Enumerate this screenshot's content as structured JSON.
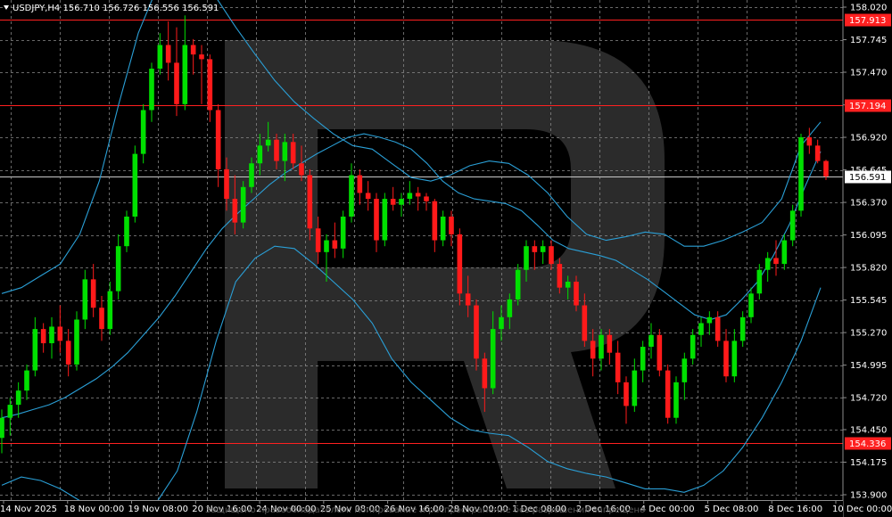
{
  "header": {
    "text": "USDJPY,H4  156.710 156.726 156.556 156.591"
  },
  "watermark": {
    "text": "Защищено правообладателем. Копирование и распространение без разрешения запрещено"
  },
  "colors": {
    "background": "#000000",
    "grid": "#8c8c8c",
    "bull": "#00e000",
    "bear": "#ff1a1a",
    "bands": "#2a9fd6",
    "level": "#ff2020",
    "current": "#c8c8c8"
  },
  "chart_data": {
    "type": "candlestick",
    "symbol": "USDJPY",
    "timeframe": "H4",
    "ohlc_readout": {
      "open": 156.71,
      "high": 156.726,
      "low": 156.556,
      "close": 156.591
    },
    "ylim": [
      153.9,
      158.02
    ],
    "y_ticks": [
      "158.020",
      "157.745",
      "157.470",
      "157.194",
      "156.920",
      "156.645",
      "156.370",
      "156.095",
      "155.820",
      "155.545",
      "155.270",
      "154.995",
      "154.720",
      "154.450",
      "154.175",
      "153.900"
    ],
    "x_ticks": [
      "14 Nov 2025",
      "18 Nov 00:00",
      "19 Nov 08:00",
      "20 Nov 16:00",
      "24 Nov 00:00",
      "25 Nov 08:00",
      "26 Nov 16:00",
      "28 Nov 00:00",
      "1 Dec 08:00",
      "2 Dec 16:00",
      "4 Dec 00:00",
      "5 Dec 08:00",
      "8 Dec 16:00",
      "10 Dec 00:00"
    ],
    "levels": [
      {
        "label": "157.913",
        "value": 157.913
      },
      {
        "label": "157.194",
        "value": 157.194
      },
      {
        "label": "154.336",
        "value": 154.336
      }
    ],
    "current_price": {
      "label": "156.591",
      "value": 156.591
    },
    "candles": [
      [
        154.38,
        154.62,
        154.25,
        154.55
      ],
      [
        154.55,
        154.72,
        154.4,
        154.66
      ],
      [
        154.66,
        154.85,
        154.55,
        154.78
      ],
      [
        154.78,
        155.0,
        154.7,
        154.95
      ],
      [
        154.95,
        155.4,
        154.9,
        155.3
      ],
      [
        155.3,
        155.35,
        155.1,
        155.18
      ],
      [
        155.18,
        155.4,
        155.05,
        155.32
      ],
      [
        155.32,
        155.5,
        155.1,
        155.2
      ],
      [
        155.2,
        155.3,
        154.9,
        155.0
      ],
      [
        155.0,
        155.45,
        154.95,
        155.38
      ],
      [
        155.38,
        155.8,
        155.3,
        155.72
      ],
      [
        155.72,
        155.85,
        155.4,
        155.48
      ],
      [
        155.48,
        155.58,
        155.2,
        155.3
      ],
      [
        155.3,
        155.7,
        155.25,
        155.62
      ],
      [
        155.62,
        156.1,
        155.55,
        156.0
      ],
      [
        156.0,
        156.3,
        155.95,
        156.25
      ],
      [
        156.25,
        156.85,
        156.2,
        156.78
      ],
      [
        156.78,
        157.2,
        156.7,
        157.15
      ],
      [
        157.15,
        157.55,
        157.05,
        157.5
      ],
      [
        157.5,
        157.8,
        157.45,
        157.7
      ],
      [
        157.7,
        157.9,
        157.4,
        157.55
      ],
      [
        157.55,
        157.85,
        157.1,
        157.2
      ],
      [
        157.2,
        157.95,
        157.15,
        157.7
      ],
      [
        157.7,
        157.75,
        157.45,
        157.62
      ],
      [
        157.62,
        157.7,
        157.2,
        157.58
      ],
      [
        157.58,
        157.62,
        157.05,
        157.15
      ],
      [
        157.15,
        157.2,
        156.5,
        156.65
      ],
      [
        156.65,
        156.75,
        156.3,
        156.4
      ],
      [
        156.4,
        156.6,
        156.1,
        156.2
      ],
      [
        156.2,
        156.55,
        156.15,
        156.5
      ],
      [
        156.5,
        156.75,
        156.45,
        156.7
      ],
      [
        156.7,
        156.95,
        156.6,
        156.85
      ],
      [
        156.85,
        157.05,
        156.8,
        156.9
      ],
      [
        156.9,
        156.95,
        156.65,
        156.72
      ],
      [
        156.72,
        156.95,
        156.55,
        156.88
      ],
      [
        156.88,
        156.95,
        156.65,
        156.7
      ],
      [
        156.7,
        156.85,
        156.55,
        156.6
      ],
      [
        156.6,
        156.65,
        156.05,
        156.15
      ],
      [
        156.15,
        156.25,
        155.85,
        155.95
      ],
      [
        155.95,
        156.1,
        155.7,
        156.05
      ],
      [
        156.05,
        156.2,
        155.9,
        155.98
      ],
      [
        155.98,
        156.3,
        155.9,
        156.25
      ],
      [
        156.25,
        156.7,
        156.2,
        156.6
      ],
      [
        156.6,
        156.65,
        156.35,
        156.45
      ],
      [
        156.45,
        156.55,
        156.3,
        156.4
      ],
      [
        156.4,
        156.45,
        155.95,
        156.05
      ],
      [
        156.05,
        156.45,
        156.0,
        156.4
      ],
      [
        156.4,
        156.5,
        156.3,
        156.35
      ],
      [
        156.35,
        156.45,
        156.25,
        156.4
      ],
      [
        156.4,
        156.55,
        156.35,
        156.45
      ],
      [
        156.45,
        156.5,
        156.3,
        156.42
      ],
      [
        156.42,
        156.45,
        156.3,
        156.38
      ],
      [
        156.38,
        156.4,
        155.95,
        156.05
      ],
      [
        156.05,
        156.3,
        156.0,
        156.25
      ],
      [
        156.25,
        156.3,
        156.0,
        156.1
      ],
      [
        156.1,
        156.15,
        155.5,
        155.6
      ],
      [
        155.6,
        155.75,
        155.4,
        155.5
      ],
      [
        155.5,
        155.55,
        154.95,
        155.05
      ],
      [
        155.05,
        155.1,
        154.6,
        154.8
      ],
      [
        154.8,
        155.45,
        154.75,
        155.3
      ],
      [
        155.3,
        155.5,
        155.2,
        155.4
      ],
      [
        155.4,
        155.6,
        155.3,
        155.55
      ],
      [
        155.55,
        155.85,
        155.5,
        155.8
      ],
      [
        155.8,
        156.05,
        155.7,
        156.0
      ],
      [
        156.0,
        156.05,
        155.8,
        155.95
      ],
      [
        155.95,
        156.05,
        155.85,
        156.0
      ],
      [
        156.0,
        156.05,
        155.8,
        155.85
      ],
      [
        155.85,
        155.9,
        155.6,
        155.65
      ],
      [
        155.65,
        155.75,
        155.55,
        155.7
      ],
      [
        155.7,
        155.75,
        155.45,
        155.5
      ],
      [
        155.5,
        155.6,
        155.15,
        155.2
      ],
      [
        155.2,
        155.3,
        154.9,
        155.05
      ],
      [
        155.05,
        155.3,
        154.95,
        155.25
      ],
      [
        155.25,
        155.3,
        155.0,
        155.1
      ],
      [
        155.1,
        155.2,
        154.75,
        154.85
      ],
      [
        154.85,
        154.9,
        154.5,
        154.65
      ],
      [
        154.65,
        155.05,
        154.6,
        154.95
      ],
      [
        154.95,
        155.2,
        154.85,
        155.15
      ],
      [
        155.15,
        155.35,
        155.05,
        155.25
      ],
      [
        155.25,
        155.3,
        154.9,
        154.95
      ],
      [
        154.95,
        155.0,
        154.5,
        154.55
      ],
      [
        154.55,
        154.9,
        154.5,
        154.85
      ],
      [
        154.85,
        155.1,
        154.7,
        155.05
      ],
      [
        155.05,
        155.3,
        155.0,
        155.25
      ],
      [
        155.25,
        155.4,
        155.15,
        155.35
      ],
      [
        155.35,
        155.45,
        155.25,
        155.4
      ],
      [
        155.4,
        155.45,
        155.15,
        155.2
      ],
      [
        155.2,
        155.3,
        154.85,
        154.9
      ],
      [
        154.9,
        155.3,
        154.85,
        155.2
      ],
      [
        155.2,
        155.45,
        155.15,
        155.4
      ],
      [
        155.4,
        155.65,
        155.35,
        155.6
      ],
      [
        155.6,
        155.85,
        155.55,
        155.8
      ],
      [
        155.8,
        155.95,
        155.7,
        155.9
      ],
      [
        155.9,
        156.05,
        155.75,
        155.85
      ],
      [
        155.85,
        156.1,
        155.8,
        156.05
      ],
      [
        156.05,
        156.35,
        156.0,
        156.3
      ],
      [
        156.3,
        156.95,
        156.25,
        156.92
      ],
      [
        156.92,
        157.0,
        156.78,
        156.85
      ],
      [
        156.85,
        156.9,
        156.7,
        156.72
      ],
      [
        156.72,
        156.73,
        156.56,
        156.59
      ]
    ],
    "bollinger": {
      "mid": [
        154.55,
        154.58,
        154.62,
        154.66,
        154.72,
        154.8,
        154.88,
        154.98,
        155.1,
        155.25,
        155.4,
        155.58,
        155.78,
        155.98,
        156.15,
        156.28,
        156.4,
        156.52,
        156.62,
        156.7,
        156.78,
        156.85,
        156.92,
        156.95,
        156.92,
        156.88,
        156.82,
        156.7,
        156.55,
        156.45,
        156.4,
        156.38,
        156.36,
        156.3,
        156.18,
        156.05,
        155.98,
        155.95,
        155.92,
        155.88,
        155.8,
        155.72,
        155.62,
        155.52,
        155.42,
        155.38,
        155.42,
        155.55,
        155.7,
        155.92,
        156.18,
        156.5,
        156.8
      ],
      "upper": [
        155.6,
        155.65,
        155.75,
        155.85,
        156.1,
        156.55,
        157.2,
        157.8,
        158.2,
        158.4,
        158.35,
        158.1,
        157.85,
        157.62,
        157.4,
        157.22,
        157.08,
        156.95,
        156.85,
        156.82,
        156.7,
        156.58,
        156.55,
        156.6,
        156.68,
        156.72,
        156.7,
        156.6,
        156.45,
        156.25,
        156.1,
        156.05,
        156.08,
        156.12,
        156.1,
        156.0,
        156.0,
        156.05,
        156.12,
        156.2,
        156.4,
        156.85,
        157.05
      ],
      "lower": [
        153.98,
        154.05,
        154.02,
        153.95,
        153.85,
        153.75,
        153.7,
        153.75,
        153.85,
        154.1,
        154.6,
        155.2,
        155.7,
        155.9,
        156.0,
        155.98,
        155.85,
        155.7,
        155.55,
        155.35,
        155.05,
        154.85,
        154.7,
        154.55,
        154.45,
        154.42,
        154.4,
        154.3,
        154.18,
        154.12,
        154.08,
        154.05,
        154.0,
        153.95,
        153.95,
        153.92,
        153.98,
        154.1,
        154.3,
        154.55,
        154.85,
        155.2,
        155.65
      ]
    }
  }
}
